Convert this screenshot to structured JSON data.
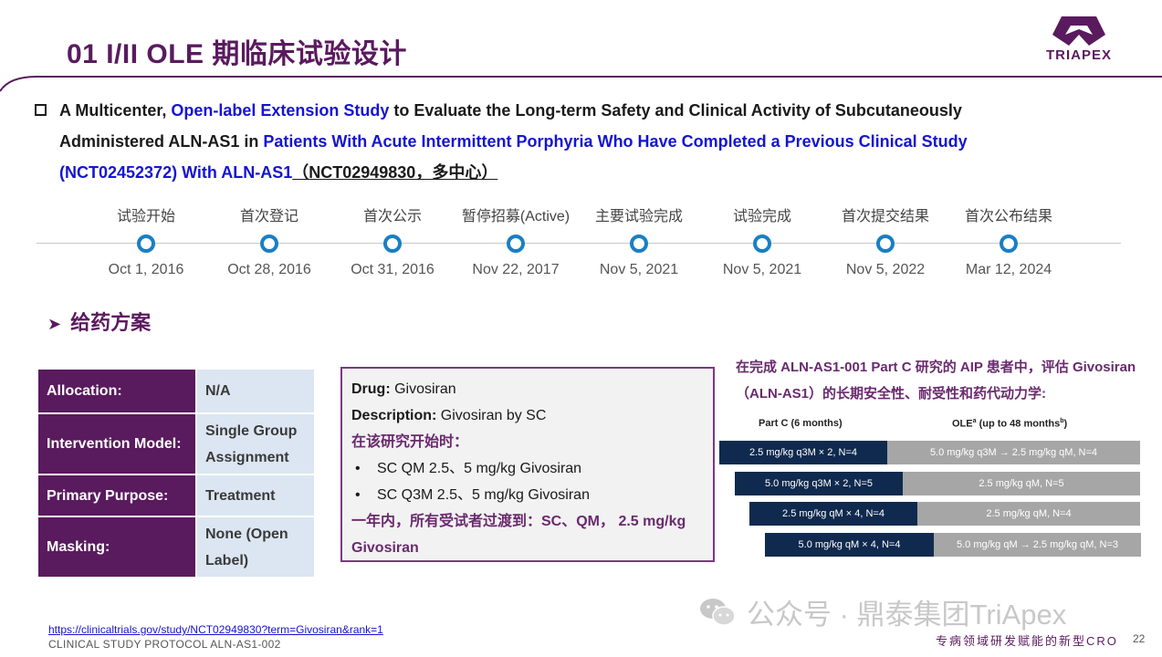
{
  "header": {
    "title": "01 I/II OLE 期临床试验设计",
    "logo_text": "TRIAPEX"
  },
  "study": {
    "seg1": "A Multicenter, ",
    "seg2": "Open-label Extension Study",
    "seg3": " to Evaluate the Long-term Safety and Clinical Activity of Subcutaneously",
    "seg4": "Administered ALN-AS1 in ",
    "seg5": "Patients With Acute Intermittent Porphyria Who Have Completed a Previous Clinical Study",
    "seg6": "(NCT02452372) With ALN-AS1",
    "seg7": "（NCT02949830，多中心）"
  },
  "timeline": [
    {
      "label": "试验开始",
      "date": "Oct 1, 2016"
    },
    {
      "label": "首次登记",
      "date": "Oct 28, 2016"
    },
    {
      "label": "首次公示",
      "date": "Oct 31, 2016"
    },
    {
      "label": "暂停招募(Active)",
      "date": "Nov 22, 2017"
    },
    {
      "label": "主要试验完成",
      "date": "Nov 5, 2021"
    },
    {
      "label": "试验完成",
      "date": "Nov 5, 2021"
    },
    {
      "label": "首次提交结果",
      "date": "Nov 5, 2022"
    },
    {
      "label": "首次公布结果",
      "date": "Mar 12, 2024"
    }
  ],
  "section_title": "给药方案",
  "design_table": [
    {
      "key": "Allocation:",
      "value": "N/A"
    },
    {
      "key": "Intervention Model:",
      "value": "Single Group Assignment"
    },
    {
      "key": "Primary Purpose:",
      "value": "Treatment"
    },
    {
      "key": "Masking:",
      "value": "None (Open Label)"
    }
  ],
  "drug": {
    "drug_label": "Drug:",
    "drug_value": " Givosiran",
    "desc_label": "Description:",
    "desc_value": " Givosiran by SC",
    "start_note": "在该研究开始时：",
    "bullet1": "SC QM 2.5、5 mg/kg Givosiran",
    "bullet2": "SC Q3M 2.5、5 mg/kg Givosiran",
    "transition": "一年内，所有受试者过渡到：SC、QM， 2.5 mg/kg Givosiran",
    "bullet_glyph": "•"
  },
  "regimen": {
    "title": "在完成 ALN-AS1-001 Part C 研究的 AIP 患者中，评估 Givosiran（ALN-AS1）的长期安全性、耐受性和药代动力学:",
    "col_part_c": "Part C (6 months)",
    "col_ole": "OLE",
    "col_ole_sup": "a",
    "col_ole_rest": " (up to 48 months",
    "col_ole_sup2": "b",
    "col_ole_end": ")",
    "rows": [
      {
        "part_c": "2.5 mg/kg q3M × 2, N=4",
        "ole": "5.0 mg/kg q3M → 2.5 mg/kg qM, N=4"
      },
      {
        "part_c": "5.0 mg/kg q3M × 2, N=5",
        "ole": "2.5 mg/kg qM, N=5"
      },
      {
        "part_c": "2.5 mg/kg qM × 4, N=4",
        "ole": "2.5 mg/kg qM, N=4"
      },
      {
        "part_c": "5.0 mg/kg qM × 4, N=4",
        "ole": "5.0 mg/kg qM → 2.5 mg/kg qM, N=3"
      }
    ]
  },
  "footer": {
    "url": "https://clinicaltrials.gov/study/NCT02949830?term=Givosiran&rank=1",
    "protocol": "CLINICAL STUDY PROTOCOL  ALN-AS1-002",
    "watermark": "公众号 · 鼎泰集团TriApex",
    "tagline": "专病领域研发赋能的新型CRO",
    "page": "22"
  },
  "colors": {
    "brand_purple": "#5a1a5e",
    "link_blue": "#1414d4",
    "timeline_dot": "#1a7fc4",
    "bar_dark": "#0f2a4e",
    "bar_grey": "#a6a6a6",
    "table_value_bg": "#dce6f2"
  },
  "icons": [
    "triapex-logo-icon",
    "checkbox-square-icon",
    "arrow-right-icon",
    "wechat-icon"
  ]
}
